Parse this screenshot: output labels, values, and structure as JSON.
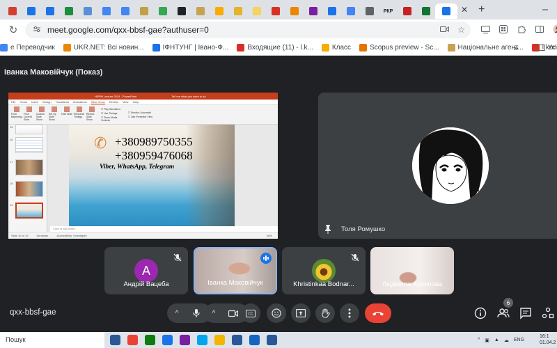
{
  "browser": {
    "url": "meet.google.com/qxx-bbsf-gae?authuser=0",
    "tab_close": "✕",
    "new_tab": "+",
    "tab_favicons": [
      "#d23f31",
      "#1a73e8",
      "#1a73e8",
      "#1e8e3e",
      "#5b8fd6",
      "#4285f4",
      "#4285f4",
      "#c2a047",
      "#34a853",
      "#202124",
      "#c7a252",
      "#f9ab00",
      "#e5b22b",
      "#f4d35e",
      "#d93025",
      "#ea8600",
      "#7b1fa2",
      "#1a73e8",
      "#4285f4",
      "#5f6368",
      "#202124",
      "#c5221f",
      "#137333",
      "#1a73e8"
    ],
    "tab_labels": [
      "РКР"
    ],
    "bookmarks": [
      {
        "label": "е Переводчик",
        "color": "#4285f4"
      },
      {
        "label": "UKR.NET: Всі новин...",
        "color": "#ea8600"
      },
      {
        "label": "ІФНТУНГ | Івано-Ф...",
        "color": "#1a73e8"
      },
      {
        "label": "Входящие (11) - l.k...",
        "color": "#d93025"
      },
      {
        "label": "Класс",
        "color": "#f9ab00"
      },
      {
        "label": "Scopus preview - Sc...",
        "color": "#e37400"
      },
      {
        "label": "Національне агент...",
        "color": "#c7a252"
      },
      {
        "label": "l.konsevich@nung.e...",
        "color": "#d93025"
      }
    ],
    "bookmarks_more": "»",
    "bookmarks_folder": "Усі"
  },
  "meet": {
    "presenter_title": "Іванка Маковійчук (Показ)",
    "presentation": {
      "window_title": "HRPM Lecture 2024 - PowerPoint",
      "ribbon_tabs": [
        "File",
        "Home",
        "Insert",
        "Design",
        "Transitions",
        "Animations",
        "Slide Show",
        "Review",
        "View",
        "Help"
      ],
      "active_tab": "Slide Show",
      "tell_me": "Tell me what you want to do",
      "ribbon_buttons": [
        "From Beginning",
        "From Current Slide",
        "Custom Slide Show",
        "Set Up Slide Show",
        "Hide Slide",
        "Rehearse Timings",
        "Record Slide Show"
      ],
      "ribbon_options": [
        "Play Narrations",
        "Use Timings",
        "Show Media Controls"
      ],
      "monitor_options": [
        "Monitor: Automatic",
        "Use Presenter View"
      ],
      "thumb_numbers": [
        "15",
        "16",
        "17",
        "18",
        "19"
      ],
      "slide_phone_1": "+380989750355",
      "slide_phone_2": "+380959476068",
      "slide_apps": "Viber, WhatsApp, Telegram",
      "notes_placeholder": "Click to add notes",
      "status_slide": "Slide 19 of 19",
      "status_lang": "Ukrainian",
      "status_access": "Accessibility: Investigate",
      "status_zoom": "46%"
    },
    "pinned_participant": "Толя Ромушко",
    "participants": [
      {
        "name": "Андрій Вацеба",
        "initial": "A"
      },
      {
        "name": "Іванка Маковійчук"
      },
      {
        "name": "Khristinkaa Bodnar..."
      },
      {
        "name": "Людмила Архипова"
      }
    ],
    "meeting_code": "qxx-bbsf-gae",
    "people_count": "6",
    "caret_up": "^"
  },
  "taskbar": {
    "search_label": "Пошук",
    "lang": "ENG",
    "time": "16:1",
    "date": "01.04.2",
    "app_colors": [
      "#2b5797",
      "#ea4335",
      "#0f7b0f",
      "#1a73e8",
      "#7b1fa2",
      "#00a4ef",
      "#f4b400",
      "#2b579a",
      "#1565c0",
      "#2b5797"
    ]
  },
  "colors": {
    "meet_bg": "#202124",
    "tile_bg": "#3c4043",
    "end_call": "#ea4335",
    "speaking_border": "#8ab4f8",
    "avatar_a": "#9c27b0"
  }
}
